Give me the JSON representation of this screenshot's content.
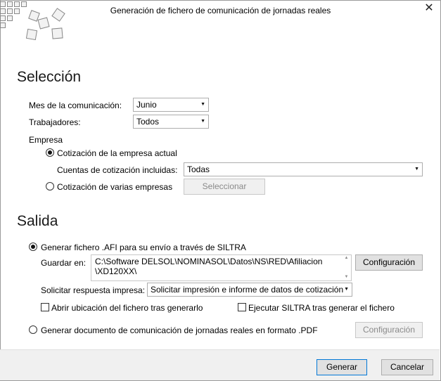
{
  "window": {
    "title": "Generación de fichero de comunicación de jornadas reales",
    "close_glyph": "✕"
  },
  "seleccion": {
    "heading": "Selección",
    "mes_label": "Mes de la comunicación:",
    "mes_value": "Junio",
    "trabajadores_label": "Trabajadores:",
    "trabajadores_value": "Todos",
    "empresa_label": "Empresa",
    "opt_actual": "Cotización de la empresa actual",
    "cuentas_label": "Cuentas de cotización incluidas:",
    "cuentas_value": "Todas",
    "opt_varias": "Cotización de varias empresas",
    "seleccionar_btn": "Seleccionar"
  },
  "salida": {
    "heading": "Salida",
    "opt_afi": "Generar fichero .AFI para su envío a través de SILTRA",
    "guardar_label": "Guardar en:",
    "path_line1": "C:\\Software DELSOL\\NOMINASOL\\Datos\\NS\\RED\\Afiliacion",
    "path_line2": "\\XD120XX\\",
    "config_btn": "Configuración",
    "respuesta_label": "Solicitar respuesta impresa:",
    "respuesta_value": "Solicitar impresión e informe de datos de cotización",
    "abrir_label": "Abrir ubicación del fichero tras generarlo",
    "ejecutar_label": "Ejecutar SILTRA tras generar el fichero",
    "opt_pdf": "Generar documento de comunicación de jornadas reales en formato .PDF",
    "config_pdf_btn": "Configuración"
  },
  "footer": {
    "generar_btn": "Generar",
    "cancelar_btn": "Cancelar"
  },
  "icons": {
    "dropdown_arrow": "▼",
    "scroll_up": "▲",
    "scroll_down": "▼"
  }
}
